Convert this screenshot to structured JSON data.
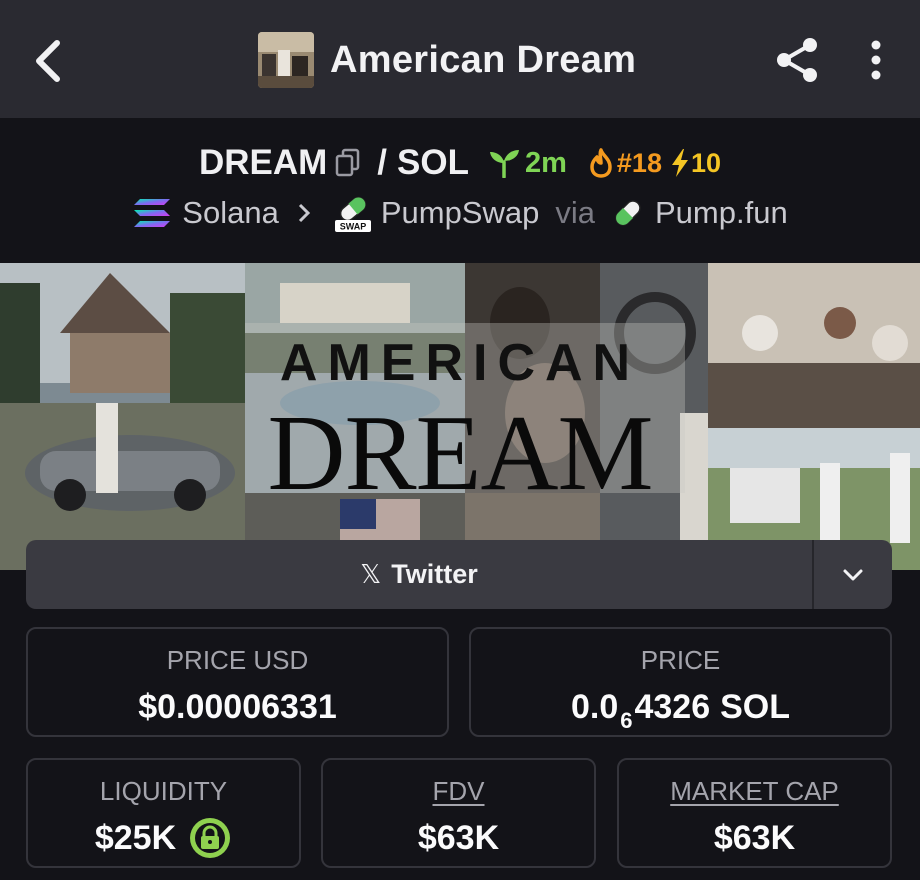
{
  "header": {
    "title": "American Dream"
  },
  "pair": {
    "base": "DREAM",
    "separator": "/",
    "quote": "SOL",
    "age": "2m",
    "rank": "#18",
    "boosts": "10"
  },
  "chain": {
    "network": "Solana",
    "dex": "PumpSwap",
    "via_label": "via",
    "launchpad": "Pump.fun",
    "dex_badge": "SWAP"
  },
  "banner": {
    "line1": "AMERICAN",
    "line2": "DREAM"
  },
  "socials": {
    "primary_label": "Twitter"
  },
  "stats": {
    "price_usd": {
      "label": "PRICE USD",
      "value": "$0.00006331"
    },
    "price_native": {
      "label": "PRICE",
      "prefix": "0.0",
      "zeros": "6",
      "digits": "4326",
      "unit": "SOL"
    },
    "liquidity": {
      "label": "LIQUIDITY",
      "value": "$25K"
    },
    "fdv": {
      "label": "FDV",
      "value": "$63K"
    },
    "market_cap": {
      "label": "MARKET CAP",
      "value": "$63K"
    }
  },
  "colors": {
    "background": "#131318",
    "appbar": "#2a2a31",
    "age_green": "#7fd455",
    "rank_orange": "#f49a1f",
    "boost_yellow": "#f4c524",
    "lock_green": "#8fd14f"
  }
}
